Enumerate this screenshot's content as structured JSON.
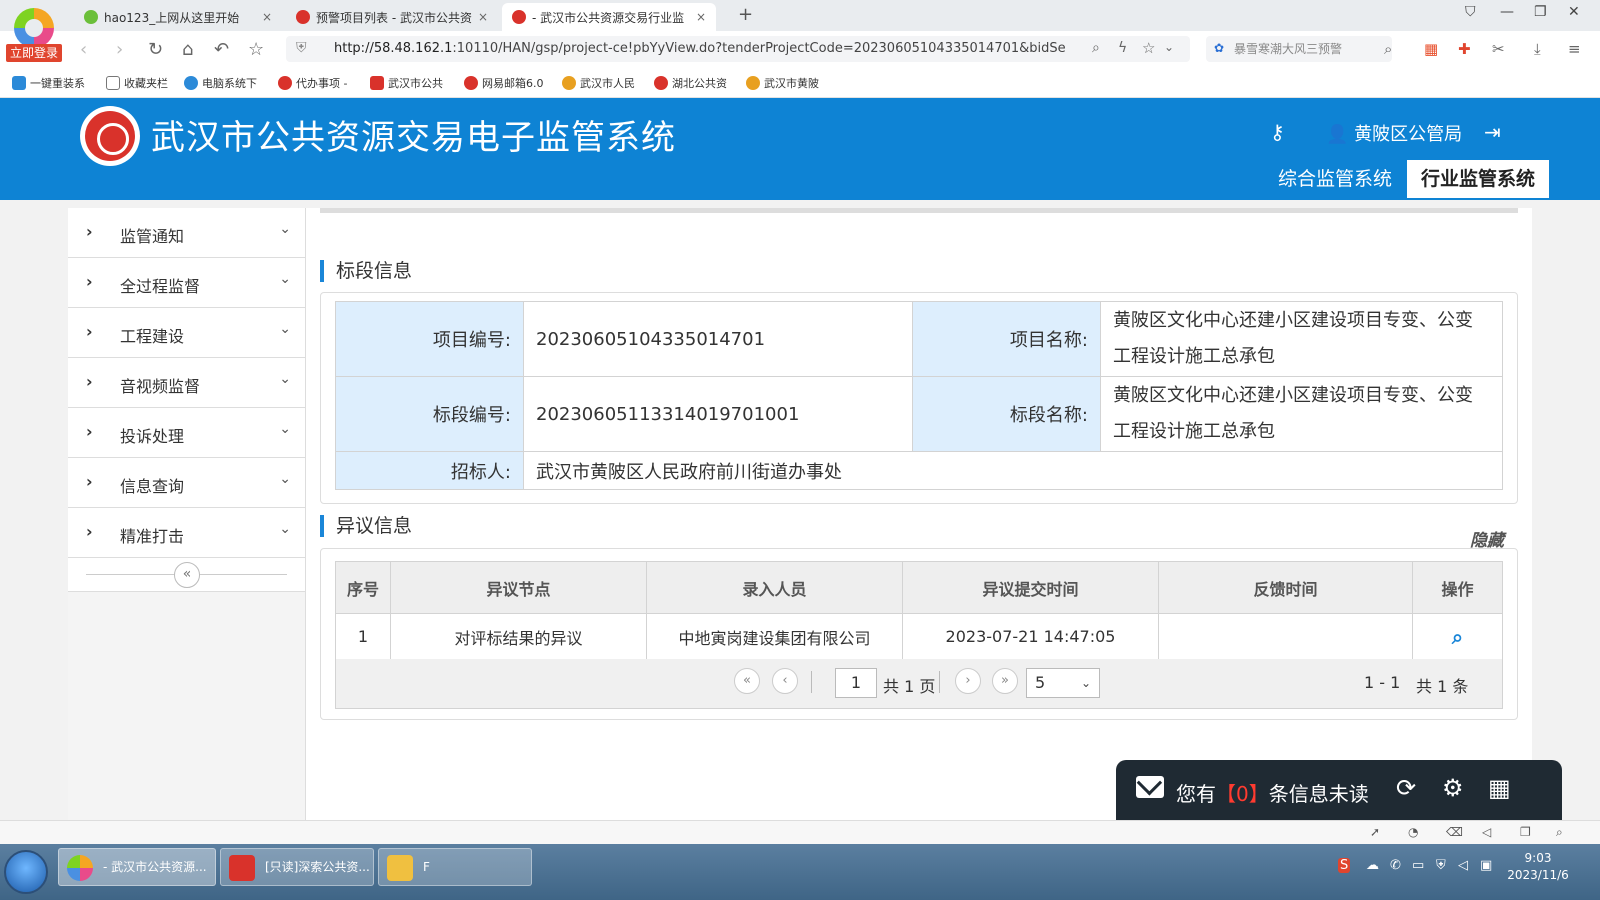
{
  "browser": {
    "login_tag": "立即登录",
    "tabs": [
      {
        "label": "hao123_上网从这里开始",
        "close": "×"
      },
      {
        "label": "预警项目列表 - 武汉市公共资",
        "close": "×"
      },
      {
        "label": "- 武汉市公共资源交易行业监",
        "close": "×"
      }
    ],
    "new_tab": "+",
    "url_host": "http://58.48.162.1",
    "url_rest": ":10110/HAN/gsp/project-ce!pbYyView.do?tenderProjectCode=20230605104335014701&bidSe",
    "search_text": "暴雪寒潮大风三预警",
    "bookmarks": [
      "一键重装系",
      "收藏夹栏",
      "电脑系统下",
      "代办事项 -",
      "武汉市公共",
      "网易邮箱6.0",
      "武汉市人民",
      "湖北公共资",
      "武汉市黄陂"
    ]
  },
  "header": {
    "title": "武汉市公共资源交易电子监管系统",
    "user": "黄陂区公管局",
    "system_tabs": [
      "综合监管系统",
      "行业监管系统"
    ]
  },
  "sidebar": {
    "items": [
      "监管通知",
      "全过程监督",
      "工程建设",
      "音视频监督",
      "投诉处理",
      "信息查询",
      "精准打击"
    ]
  },
  "section_bid": {
    "title": "标段信息",
    "project_code_label": "项目编号:",
    "project_code": "20230605104335014701",
    "project_name_label": "项目名称:",
    "project_name": "黄陂区文化中心还建小区建设项目专变、公变工程设计施工总承包",
    "bid_code_label": "标段编号:",
    "bid_code": "2023060511331401970100­1",
    "bid_name_label": "标段名称:",
    "bid_name": "黄陂区文化中心还建小区建设项目专变、公变工程设计施工总承包",
    "tenderer_label": "招标人:",
    "tenderer": "武汉市黄陂区人民政府前川街道办事处"
  },
  "section_objection": {
    "title": "异议信息",
    "hide_label": "隐藏",
    "columns": [
      "序号",
      "异议节点",
      "录入人员",
      "异议提交时间",
      "反馈时间",
      "操作"
    ],
    "rows": [
      {
        "no": "1",
        "node": "对评标结果的异议",
        "person": "中地寅岗建设集团有限公司",
        "submit_time": "2023-07-21 14:47:05",
        "feedback_time": ""
      }
    ],
    "pager": {
      "page": "1",
      "total_pages_text": "共 1 页",
      "page_size": "5",
      "range_text": "1 - 1",
      "total_text": "共 1 条"
    }
  },
  "message": {
    "prefix": "您有",
    "count": "【0】",
    "suffix": "条信息未读"
  },
  "taskbar": {
    "tasks": [
      "- 武汉市公共资源...",
      "[只读]深索公共资...",
      "F"
    ],
    "time": "9:03",
    "date": "2023/11/6"
  }
}
